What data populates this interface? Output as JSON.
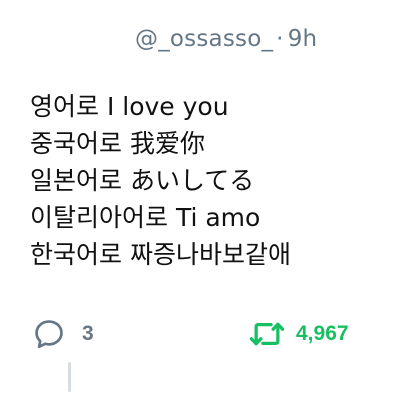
{
  "header": {
    "handle": "@_ossasso_",
    "separator": "·",
    "time": "9h"
  },
  "tweet": {
    "lines": [
      "영어로 I love you",
      "중국어로 我爱你",
      "일본어로 あいしてる",
      "이탈리아어로 Ti amo",
      "한국어로 짜증나바보같애"
    ]
  },
  "actions": {
    "reply": {
      "icon": "reply-icon",
      "count": "3"
    },
    "retweet": {
      "icon": "retweet-icon",
      "count": "4,967",
      "color": "#17bf63"
    }
  },
  "colors": {
    "muted": "#657786",
    "text": "#111111",
    "retweet_active": "#17bf63",
    "thread_line": "#d6dce0"
  }
}
